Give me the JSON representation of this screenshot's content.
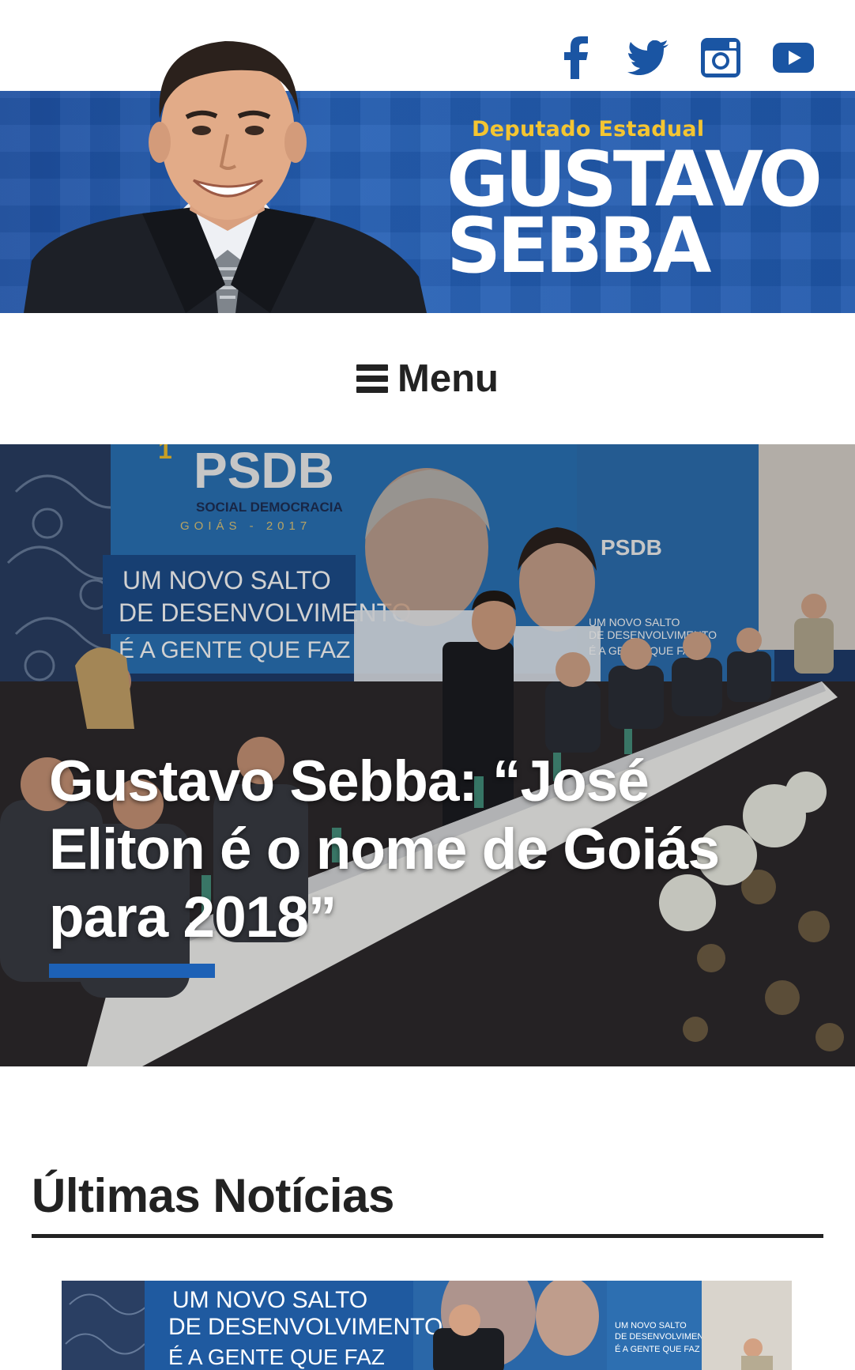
{
  "header": {
    "subtitle": "Deputado Estadual",
    "name_line1": "GUSTAVO",
    "name_line2": "SEBBA",
    "social": [
      {
        "icon": "facebook-icon",
        "label": "f"
      },
      {
        "icon": "twitter-icon",
        "label": "twitter"
      },
      {
        "icon": "instagram-icon",
        "label": "instagram"
      },
      {
        "icon": "youtube-icon",
        "label": "youtube"
      }
    ],
    "colors": {
      "banner": "#2560b5",
      "accent_yellow": "#f4c531",
      "icon_blue": "#1a55a3"
    }
  },
  "menu": {
    "label": "Menu"
  },
  "hero": {
    "headline": "Gustavo Sebba: “José Eliton é o nome de Goiás para 2018”",
    "underline_color": "#1d61b6",
    "banner_texts": {
      "psdb": "PSDB",
      "social_democracia": "SOCIAL DEMOCRACIA",
      "goias": "GOIÁS - 2017",
      "slogan1": "UM NOVO SALTO",
      "slogan2": "DE DESENVOLVIMENTO",
      "slogan3": "É A GENTE QUE FAZ"
    }
  },
  "news": {
    "heading": "Últimas Notícias",
    "thumb_texts": {
      "slogan1": "UM NOVO SALTO",
      "slogan2": "DE DESENVOLVIMENTO",
      "slogan3": "É A GENTE QUE FAZ"
    }
  }
}
